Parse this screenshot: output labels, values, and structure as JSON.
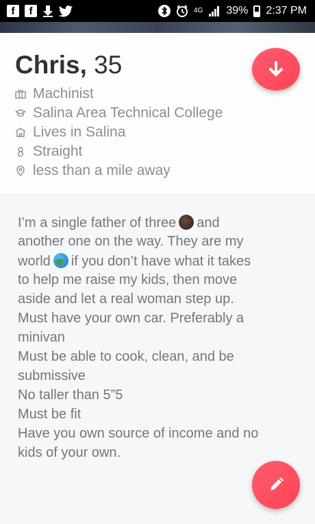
{
  "status_bar": {
    "battery": "39%",
    "time": "2:37 PM",
    "network": "4G",
    "icons": [
      "facebook-icon",
      "facebook-icon",
      "download-icon",
      "twitter-icon",
      "bluetooth-icon",
      "alarm-icon",
      "signal-icon",
      "battery-icon"
    ]
  },
  "profile": {
    "name": "Chris,",
    "age": "35",
    "details": [
      {
        "icon": "briefcase-icon",
        "text": "Machinist"
      },
      {
        "icon": "graduation-cap-icon",
        "text": "Salina Area Technical College"
      },
      {
        "icon": "home-icon",
        "text": "Lives in Salina"
      },
      {
        "icon": "gender-icon",
        "text": "Straight"
      },
      {
        "icon": "location-pin-icon",
        "text": "less than a mile away"
      }
    ]
  },
  "bio": {
    "lines": [
      "I’m a single father of three",
      "and",
      "another one on the way. They are my",
      "world",
      "if you don’t have what it takes",
      "to help me raise my kids, then move",
      "aside and let a real woman step up.",
      "Must have your own car. Preferably a",
      "minivan",
      "Must be able to cook, clean, and be",
      "submissive",
      "No taller than 5”5",
      "Must be fit",
      "Have you own source of income and no",
      "kids of your own."
    ]
  },
  "colors": {
    "accent": "#ff4f61",
    "name_text": "#2f3236",
    "secondary_text": "#8a8e93",
    "bio_bg": "#f6f7f9"
  }
}
